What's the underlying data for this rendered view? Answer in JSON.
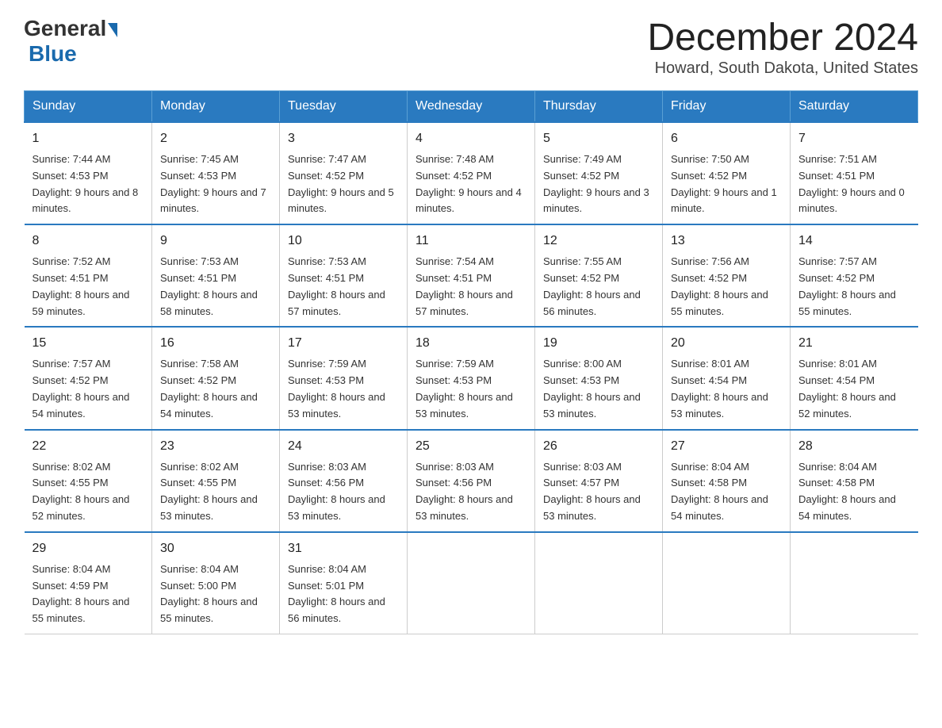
{
  "header": {
    "logo_general": "General",
    "logo_blue": "Blue",
    "month_title": "December 2024",
    "location": "Howard, South Dakota, United States"
  },
  "days_of_week": [
    "Sunday",
    "Monday",
    "Tuesday",
    "Wednesday",
    "Thursday",
    "Friday",
    "Saturday"
  ],
  "weeks": [
    [
      {
        "day": "1",
        "sunrise": "7:44 AM",
        "sunset": "4:53 PM",
        "daylight": "9 hours and 8 minutes."
      },
      {
        "day": "2",
        "sunrise": "7:45 AM",
        "sunset": "4:53 PM",
        "daylight": "9 hours and 7 minutes."
      },
      {
        "day": "3",
        "sunrise": "7:47 AM",
        "sunset": "4:52 PM",
        "daylight": "9 hours and 5 minutes."
      },
      {
        "day": "4",
        "sunrise": "7:48 AM",
        "sunset": "4:52 PM",
        "daylight": "9 hours and 4 minutes."
      },
      {
        "day": "5",
        "sunrise": "7:49 AM",
        "sunset": "4:52 PM",
        "daylight": "9 hours and 3 minutes."
      },
      {
        "day": "6",
        "sunrise": "7:50 AM",
        "sunset": "4:52 PM",
        "daylight": "9 hours and 1 minute."
      },
      {
        "day": "7",
        "sunrise": "7:51 AM",
        "sunset": "4:51 PM",
        "daylight": "9 hours and 0 minutes."
      }
    ],
    [
      {
        "day": "8",
        "sunrise": "7:52 AM",
        "sunset": "4:51 PM",
        "daylight": "8 hours and 59 minutes."
      },
      {
        "day": "9",
        "sunrise": "7:53 AM",
        "sunset": "4:51 PM",
        "daylight": "8 hours and 58 minutes."
      },
      {
        "day": "10",
        "sunrise": "7:53 AM",
        "sunset": "4:51 PM",
        "daylight": "8 hours and 57 minutes."
      },
      {
        "day": "11",
        "sunrise": "7:54 AM",
        "sunset": "4:51 PM",
        "daylight": "8 hours and 57 minutes."
      },
      {
        "day": "12",
        "sunrise": "7:55 AM",
        "sunset": "4:52 PM",
        "daylight": "8 hours and 56 minutes."
      },
      {
        "day": "13",
        "sunrise": "7:56 AM",
        "sunset": "4:52 PM",
        "daylight": "8 hours and 55 minutes."
      },
      {
        "day": "14",
        "sunrise": "7:57 AM",
        "sunset": "4:52 PM",
        "daylight": "8 hours and 55 minutes."
      }
    ],
    [
      {
        "day": "15",
        "sunrise": "7:57 AM",
        "sunset": "4:52 PM",
        "daylight": "8 hours and 54 minutes."
      },
      {
        "day": "16",
        "sunrise": "7:58 AM",
        "sunset": "4:52 PM",
        "daylight": "8 hours and 54 minutes."
      },
      {
        "day": "17",
        "sunrise": "7:59 AM",
        "sunset": "4:53 PM",
        "daylight": "8 hours and 53 minutes."
      },
      {
        "day": "18",
        "sunrise": "7:59 AM",
        "sunset": "4:53 PM",
        "daylight": "8 hours and 53 minutes."
      },
      {
        "day": "19",
        "sunrise": "8:00 AM",
        "sunset": "4:53 PM",
        "daylight": "8 hours and 53 minutes."
      },
      {
        "day": "20",
        "sunrise": "8:01 AM",
        "sunset": "4:54 PM",
        "daylight": "8 hours and 53 minutes."
      },
      {
        "day": "21",
        "sunrise": "8:01 AM",
        "sunset": "4:54 PM",
        "daylight": "8 hours and 52 minutes."
      }
    ],
    [
      {
        "day": "22",
        "sunrise": "8:02 AM",
        "sunset": "4:55 PM",
        "daylight": "8 hours and 52 minutes."
      },
      {
        "day": "23",
        "sunrise": "8:02 AM",
        "sunset": "4:55 PM",
        "daylight": "8 hours and 53 minutes."
      },
      {
        "day": "24",
        "sunrise": "8:03 AM",
        "sunset": "4:56 PM",
        "daylight": "8 hours and 53 minutes."
      },
      {
        "day": "25",
        "sunrise": "8:03 AM",
        "sunset": "4:56 PM",
        "daylight": "8 hours and 53 minutes."
      },
      {
        "day": "26",
        "sunrise": "8:03 AM",
        "sunset": "4:57 PM",
        "daylight": "8 hours and 53 minutes."
      },
      {
        "day": "27",
        "sunrise": "8:04 AM",
        "sunset": "4:58 PM",
        "daylight": "8 hours and 54 minutes."
      },
      {
        "day": "28",
        "sunrise": "8:04 AM",
        "sunset": "4:58 PM",
        "daylight": "8 hours and 54 minutes."
      }
    ],
    [
      {
        "day": "29",
        "sunrise": "8:04 AM",
        "sunset": "4:59 PM",
        "daylight": "8 hours and 55 minutes."
      },
      {
        "day": "30",
        "sunrise": "8:04 AM",
        "sunset": "5:00 PM",
        "daylight": "8 hours and 55 minutes."
      },
      {
        "day": "31",
        "sunrise": "8:04 AM",
        "sunset": "5:01 PM",
        "daylight": "8 hours and 56 minutes."
      },
      null,
      null,
      null,
      null
    ]
  ]
}
